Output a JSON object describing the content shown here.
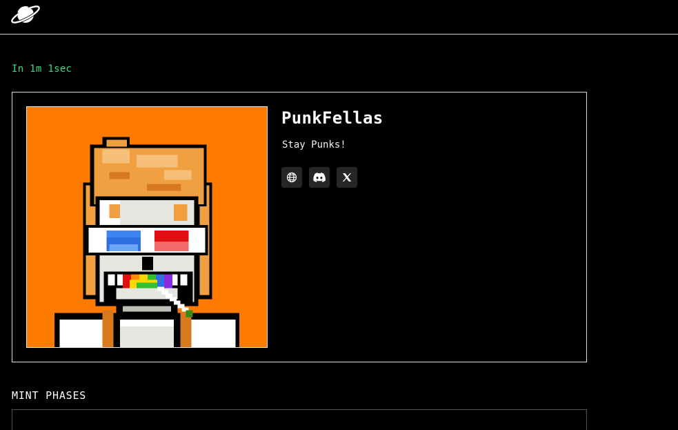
{
  "header": {
    "logo_icon": "planet-saturn-icon"
  },
  "countdown": {
    "text": "In 1m 1sec",
    "color": "#3ddc84"
  },
  "collection": {
    "name": "PunkFellas",
    "description": "Stay Punks!",
    "image_background": "#ff7a00",
    "socials": [
      {
        "icon": "globe-icon",
        "label": "Website"
      },
      {
        "icon": "discord-icon",
        "label": "Discord"
      },
      {
        "icon": "x-icon",
        "label": "X"
      }
    ]
  },
  "mint_phases": {
    "title": "MINT PHASES"
  }
}
